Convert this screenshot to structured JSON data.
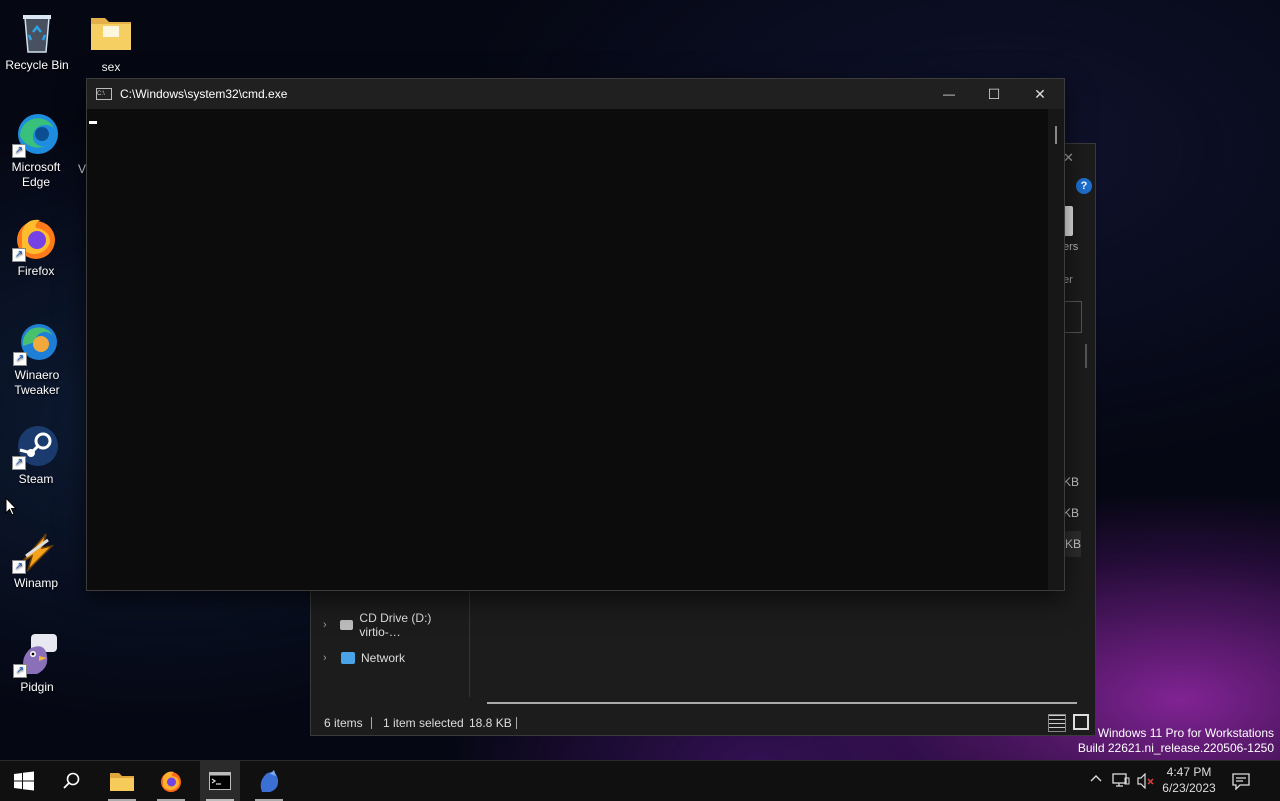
{
  "desktop": {
    "icons": [
      {
        "label": "Recycle Bin",
        "icon": "recycle-bin-icon"
      },
      {
        "label": "sex",
        "icon": "folder-icon"
      },
      {
        "label": "Microsoft Edge",
        "icon": "edge-icon"
      },
      {
        "label": "Firefox",
        "icon": "firefox-icon"
      },
      {
        "label": "Winaero Tweaker",
        "icon": "winaero-icon"
      },
      {
        "label": "Steam",
        "icon": "steam-icon"
      },
      {
        "label": "Winamp",
        "icon": "winamp-icon"
      },
      {
        "label": "Pidgin",
        "icon": "pidgin-icon"
      }
    ],
    "partial_label": "V"
  },
  "cmd_window": {
    "title": "C:\\Windows\\system32\\cmd.exe",
    "icon_text": "C:\\",
    "minimize": "—",
    "maximize": "☐",
    "close": "✕"
  },
  "explorer": {
    "ribbon_fragment_1": "ers",
    "ribbon_fragment_2": "er",
    "help": "?",
    "close": "✕",
    "file_sizes": [
      "KB",
      "KB",
      "KB"
    ],
    "nav": [
      {
        "label": "CD Drive (D:) virtio-…",
        "icon": "cd-drive-icon"
      },
      {
        "label": "Network",
        "icon": "network-icon"
      }
    ],
    "status": {
      "items": "6 items",
      "selected": "1 item selected",
      "size": "18.8 KB"
    }
  },
  "watermark": {
    "line1": "Windows 11 Pro for Workstations",
    "line2": "Build 22621.ni_release.220506-1250"
  },
  "taskbar": {
    "apps": [
      "start-icon",
      "search-icon",
      "file-explorer-icon",
      "firefox-icon",
      "cmd-icon",
      "pidgin-icon"
    ],
    "time": "4:47 PM",
    "date": "6/23/2023"
  },
  "colors": {
    "accent": "#0078d4",
    "taskbar": "#101010",
    "console_bg": "#0c0c0c"
  }
}
